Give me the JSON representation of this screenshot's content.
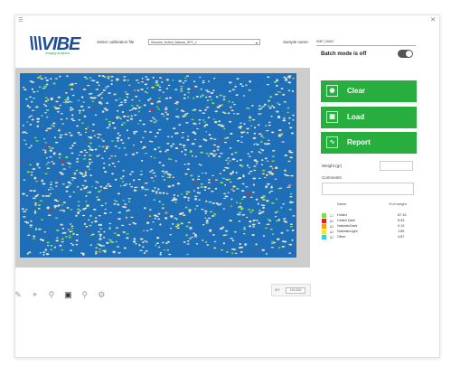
{
  "window": {
    "menu_icon": "hamburger-icon",
    "close_icon": "close-icon"
  },
  "header": {
    "logo_text": "\\\\\\VIBE",
    "logo_subtitle": "Imaging Analytics",
    "calibration_label": "Select calibration file",
    "calibration_value": "Sesame_Hulled_Natural_SPC_1",
    "sample_label": "Sample name",
    "sample_value": "SMP_03962"
  },
  "viewer": {
    "canvas_color": "#1f6fb8",
    "background_color": "#cdcdcd"
  },
  "toolbar": {
    "tools": [
      "pencil-icon",
      "crop-icon",
      "zoom-icon",
      "fill-icon",
      "pin-icon",
      "settings-pin-icon"
    ],
    "zoom_label": "X/Y",
    "zoom_value": "100,100"
  },
  "panel": {
    "batch_label": "Batch mode is off",
    "batch_on": false,
    "buttons": [
      {
        "label": "Clear",
        "icon": "camera-icon"
      },
      {
        "label": "Load",
        "icon": "image-icon"
      },
      {
        "label": "Report",
        "icon": "chart-icon"
      }
    ],
    "weight_label": "Weight (gr)",
    "weight_value": "",
    "comments_label": "Comments",
    "comments_value": ""
  },
  "legend": {
    "col_name": "Name",
    "col_pct": "% of weight",
    "rows": [
      {
        "name": "Hulled",
        "pct": "87.16",
        "color": "#7ed957",
        "checked": false
      },
      {
        "name": "Hulled Dark",
        "pct": "5.93",
        "color": "#d62728",
        "checked": true
      },
      {
        "name": "NaturalnDark",
        "pct": "0.10",
        "color": "#f0a020",
        "checked": true
      },
      {
        "name": "NaturalnLight",
        "pct": "1.85",
        "color": "#f2e33a",
        "checked": true
      },
      {
        "name": "Other",
        "pct": "4.87",
        "color": "#37d0d8",
        "checked": true
      }
    ]
  },
  "colors": {
    "accent": "#27ae3f",
    "brand": "#1d4e95"
  }
}
